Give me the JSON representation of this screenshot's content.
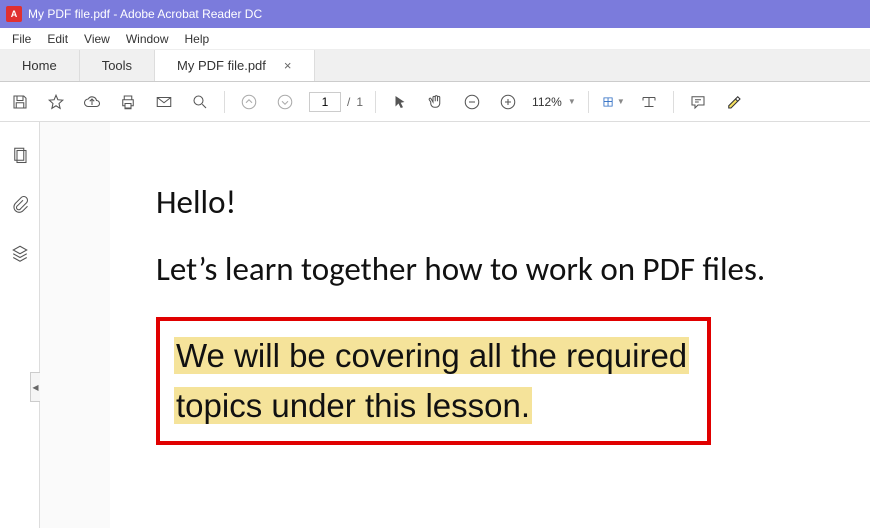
{
  "titlebar": {
    "text": "My PDF file.pdf - Adobe Acrobat Reader DC"
  },
  "menubar": {
    "items": [
      "File",
      "Edit",
      "View",
      "Window",
      "Help"
    ]
  },
  "tabs": {
    "home": "Home",
    "tools": "Tools",
    "file": "My PDF file.pdf"
  },
  "toolbar": {
    "page_current": "1",
    "page_sep": "/",
    "page_total": "1",
    "zoom": "112%"
  },
  "document": {
    "line1": "Hello!",
    "line2": "Let’s learn together how to work on PDF files.",
    "highlight1": "We will be covering all the required",
    "highlight2": "topics under this lesson."
  }
}
